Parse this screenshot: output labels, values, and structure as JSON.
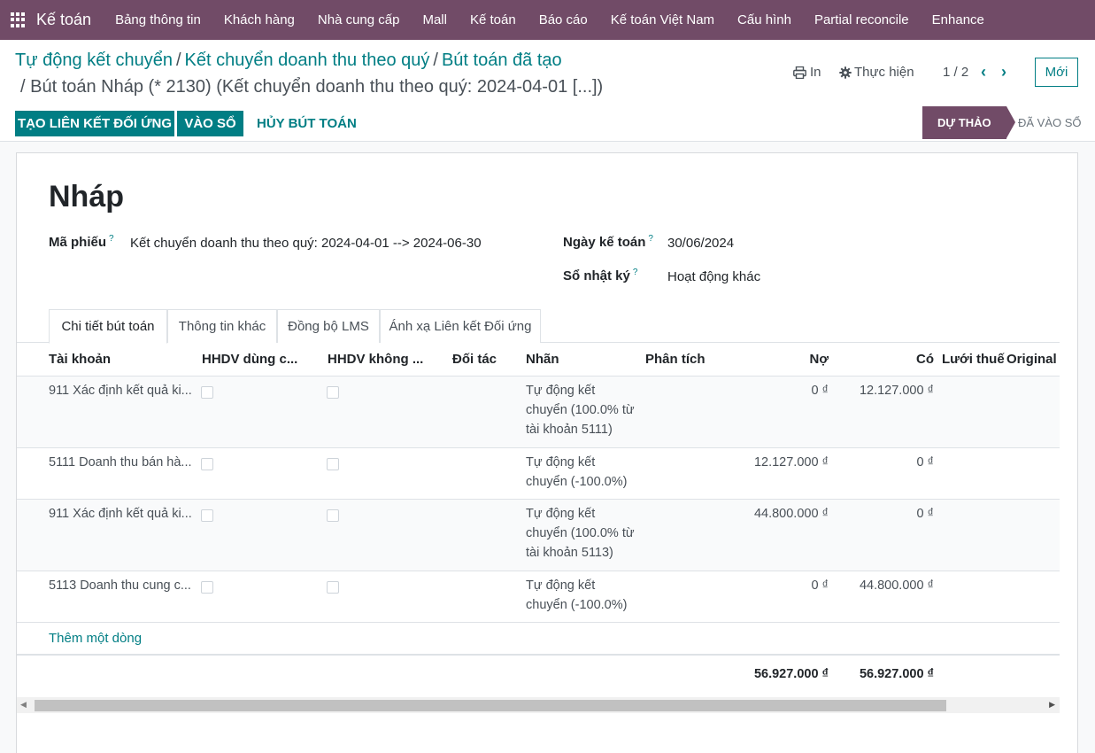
{
  "navbar": {
    "brand": "Kế toán",
    "menu": [
      "Bảng thông tin",
      "Khách hàng",
      "Nhà cung cấp",
      "Mall",
      "Kế toán",
      "Báo cáo",
      "Kế toán Việt Nam",
      "Cấu hình",
      "Partial reconcile",
      "Enhance"
    ]
  },
  "breadcrumb": {
    "items": [
      "Tự động kết chuyển",
      "Kết chuyển doanh thu theo quý",
      "Bút toán đã tạo"
    ],
    "separator": "/",
    "current": "/ Bút toán Nháp (* 2130) (Kết chuyển doanh thu theo quý: 2024-04-01 [...])"
  },
  "toolbar": {
    "print_label": "In",
    "action_label": "Thực hiện",
    "pager": "1 / 2",
    "new_label": "Mới"
  },
  "buttons": {
    "reconcile": "TẠO LIÊN KẾT ĐỐI ỨNG",
    "post": "VÀO SỔ",
    "cancel": "HỦY BÚT TOÁN"
  },
  "status": {
    "draft": "DỰ THẢO",
    "posted": "ĐÃ VÀO SỔ"
  },
  "form": {
    "title": "Nháp",
    "ref_label": "Mã phiếu",
    "ref_value": "Kết chuyển doanh thu theo quý: 2024-04-01 --> 2024-06-30",
    "date_label": "Ngày kế toán",
    "date_value": "30/06/2024",
    "journal_label": "Sổ nhật ký",
    "journal_value": "Hoạt động khác",
    "help_mark": "?"
  },
  "tabs": [
    "Chi tiết bút toán",
    "Thông tin khác",
    "Đồng bộ LMS",
    "Ánh xạ Liên kết Đối ứng"
  ],
  "table": {
    "headers": {
      "account": "Tài khoản",
      "hhdv_used": "HHDV dùng c...",
      "hhdv_not": "HHDV không ...",
      "partner": "Đối tác",
      "label": "Nhãn",
      "analytic": "Phân tích",
      "debit": "Nợ",
      "credit": "Có",
      "tax_grid": "Lưới thuế",
      "original": "Original I"
    },
    "rows": [
      {
        "account": "911 Xác định kết quả ki...",
        "label": "Tự động kết chuyển (100.0% từ tài khoản 5111)",
        "debit": "0 ₫",
        "credit": "12.127.000 ₫"
      },
      {
        "account": "5111 Doanh thu bán hà...",
        "label": "Tự động kết chuyển (-100.0%)",
        "debit": "12.127.000 ₫",
        "credit": "0 ₫"
      },
      {
        "account": "911 Xác định kết quả ki...",
        "label": "Tự động kết chuyển (100.0% từ tài khoản 5113)",
        "debit": "44.800.000 ₫",
        "credit": "0 ₫"
      },
      {
        "account": "5113 Doanh thu cung c...",
        "label": "Tự động kết chuyển (-100.0%)",
        "debit": "0 ₫",
        "credit": "44.800.000 ₫"
      }
    ],
    "add_line": "Thêm một dòng",
    "total_debit": "56.927.000 ₫",
    "total_credit": "56.927.000 ₫"
  }
}
